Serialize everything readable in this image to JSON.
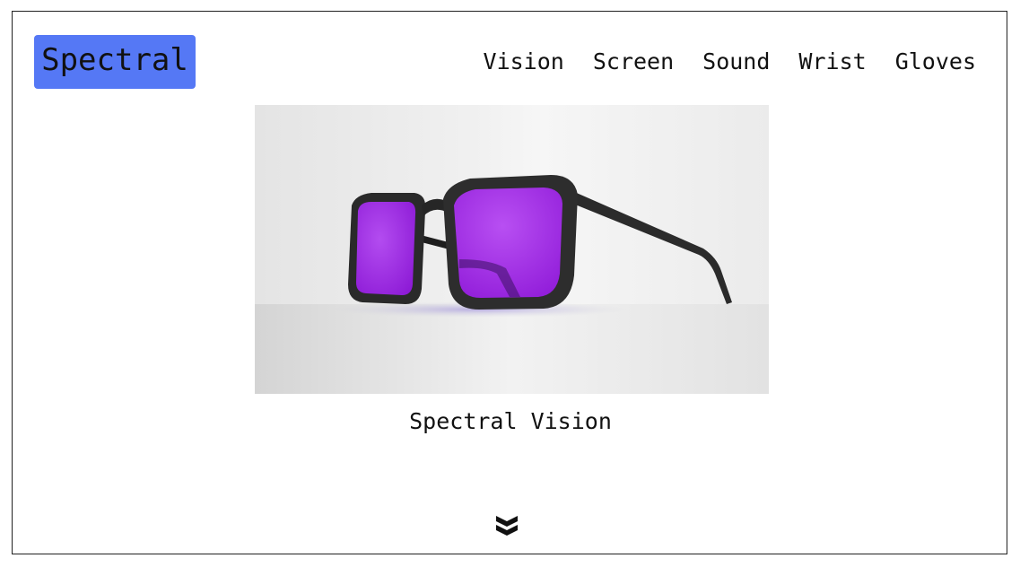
{
  "brand": {
    "logo_text": "Spectral",
    "logo_color": "#5578f5"
  },
  "nav": {
    "items": [
      {
        "label": "Vision"
      },
      {
        "label": "Screen"
      },
      {
        "label": "Sound"
      },
      {
        "label": "Wrist"
      },
      {
        "label": "Gloves"
      }
    ]
  },
  "hero": {
    "image": "sunglasses-render",
    "lens_color": "#a020e8",
    "frame_color": "#2a2a2a"
  },
  "product": {
    "title": "Spectral Vision"
  },
  "scroll": {
    "icon": "double-chevron-down-icon"
  }
}
